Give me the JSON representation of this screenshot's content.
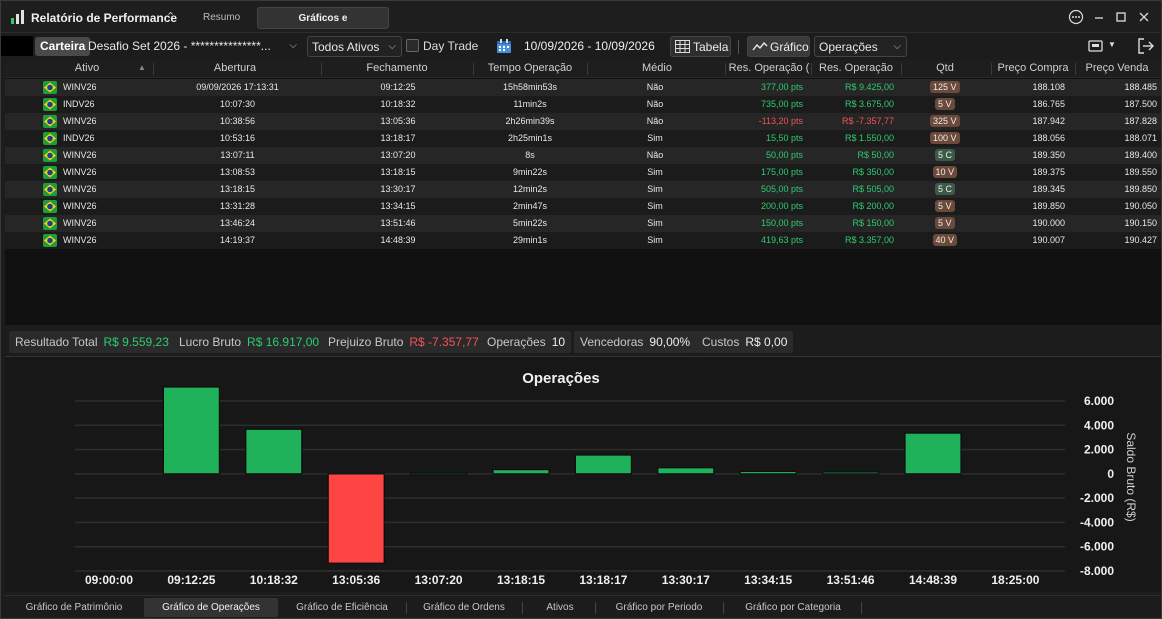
{
  "app": {
    "title": "Relatório de Performance",
    "tabs": [
      "Resumo",
      "Gráficos e Operações"
    ],
    "active_tab": "Gráficos e Operações"
  },
  "toolbar": {
    "carteira_label": "Carteira",
    "account_value": "Desafio Set 2026 - ***************...",
    "assets_value": "Todos Ativos",
    "daytrade_label": "Day Trade",
    "daytrade_checked": false,
    "date_range": "10/09/2026 - 10/09/2026",
    "tabela_label": "Tabela",
    "grafico_label": "Gráfico",
    "view_value": "Operações"
  },
  "table": {
    "columns": [
      "Ativo",
      "Abertura",
      "Fechamento",
      "Tempo Operação",
      "Médio",
      "Res. Operação (",
      "Res. Operação",
      "Qtd",
      "Preço Compra",
      "Preço Venda"
    ],
    "rows": [
      {
        "ativo": "WINV26",
        "abertura": "09/09/2026 17:13:31",
        "fechamento": "09:12:25",
        "tempo": "15h58min53s",
        "medio": "Não",
        "res_pts": "377,00 pts",
        "res_rs": "R$ 9.425,00",
        "qtd": "125 V",
        "compra": "188.108",
        "venda": "188.485",
        "sign": "pos"
      },
      {
        "ativo": "INDV26",
        "abertura": "10:07:30",
        "fechamento": "10:18:32",
        "tempo": "11min2s",
        "medio": "Não",
        "res_pts": "735,00 pts",
        "res_rs": "R$ 3.675,00",
        "qtd": "5 V",
        "compra": "186.765",
        "venda": "187.500",
        "sign": "pos"
      },
      {
        "ativo": "WINV26",
        "abertura": "10:38:56",
        "fechamento": "13:05:36",
        "tempo": "2h26min39s",
        "medio": "Não",
        "res_pts": "-113,20 pts",
        "res_rs": "R$ -7.357,77",
        "qtd": "325 V",
        "compra": "187.942",
        "venda": "187.828",
        "sign": "neg"
      },
      {
        "ativo": "INDV26",
        "abertura": "10:53:16",
        "fechamento": "13:18:17",
        "tempo": "2h25min1s",
        "medio": "Sim",
        "res_pts": "15,50 pts",
        "res_rs": "R$ 1.550,00",
        "qtd": "100 V",
        "compra": "188.056",
        "venda": "188.071",
        "sign": "pos"
      },
      {
        "ativo": "WINV26",
        "abertura": "13:07:11",
        "fechamento": "13:07:20",
        "tempo": "8s",
        "medio": "Não",
        "res_pts": "50,00 pts",
        "res_rs": "R$ 50,00",
        "qtd": "5 C",
        "compra": "189.350",
        "venda": "189.400",
        "sign": "pos"
      },
      {
        "ativo": "WINV26",
        "abertura": "13:08:53",
        "fechamento": "13:18:15",
        "tempo": "9min22s",
        "medio": "Sim",
        "res_pts": "175,00 pts",
        "res_rs": "R$ 350,00",
        "qtd": "10 V",
        "compra": "189.375",
        "venda": "189.550",
        "sign": "pos"
      },
      {
        "ativo": "WINV26",
        "abertura": "13:18:15",
        "fechamento": "13:30:17",
        "tempo": "12min2s",
        "medio": "Sim",
        "res_pts": "505,00 pts",
        "res_rs": "R$ 505,00",
        "qtd": "5 C",
        "compra": "189.345",
        "venda": "189.850",
        "sign": "pos"
      },
      {
        "ativo": "WINV26",
        "abertura": "13:31:28",
        "fechamento": "13:34:15",
        "tempo": "2min47s",
        "medio": "Sim",
        "res_pts": "200,00 pts",
        "res_rs": "R$ 200,00",
        "qtd": "5 V",
        "compra": "189.850",
        "venda": "190.050",
        "sign": "pos"
      },
      {
        "ativo": "WINV26",
        "abertura": "13:46:24",
        "fechamento": "13:51:46",
        "tempo": "5min22s",
        "medio": "Sim",
        "res_pts": "150,00 pts",
        "res_rs": "R$ 150,00",
        "qtd": "5 V",
        "compra": "190.000",
        "venda": "190.150",
        "sign": "pos"
      },
      {
        "ativo": "WINV26",
        "abertura": "14:19:37",
        "fechamento": "14:48:39",
        "tempo": "29min1s",
        "medio": "Sim",
        "res_pts": "419,63 pts",
        "res_rs": "R$ 3.357,00",
        "qtd": "40 V",
        "compra": "190.007",
        "venda": "190.427",
        "sign": "pos"
      }
    ]
  },
  "summary": [
    {
      "label": "Resultado Total",
      "value": "R$ 9.559,23",
      "sign": "pos"
    },
    {
      "label": "Lucro Bruto",
      "value": "R$ 16.917,00",
      "sign": "pos"
    },
    {
      "label": "Prejuizo Bruto",
      "value": "R$ -7.357,77",
      "sign": "neg"
    },
    {
      "label": "Operações",
      "value": "10",
      "sign": "neutral"
    },
    {
      "label": "Vencedoras",
      "value": "90,00%",
      "sign": "neutral"
    },
    {
      "label": "Custos",
      "value": "R$ 0,00",
      "sign": "neutral"
    }
  ],
  "colors": {
    "positive": "#1fb25a",
    "negative": "#ff4444",
    "pos_text": "#2ecc71",
    "neg_text": "#f05454"
  },
  "chart_data": {
    "type": "bar",
    "title": "Operações",
    "ylabel": "Saldo Bruto (R$)",
    "x_ticks": [
      "09:00:00",
      "09:12:25",
      "10:18:32",
      "13:05:36",
      "13:07:20",
      "13:18:15",
      "13:18:17",
      "13:30:17",
      "13:34:15",
      "13:51:46",
      "14:48:39",
      "18:25:00"
    ],
    "categories": [
      "09:12:25",
      "10:18:32",
      "13:05:36",
      "13:07:20",
      "13:18:15",
      "13:18:17",
      "13:30:17",
      "13:34:15",
      "13:51:46",
      "14:48:39"
    ],
    "values": [
      9425,
      3675,
      -7357.77,
      50,
      350,
      1550,
      505,
      200,
      150,
      3357
    ],
    "ylim": [
      -8000,
      6500
    ],
    "y_ticks": [
      6000,
      4000,
      2000,
      0,
      -2000,
      -4000,
      -6000,
      -8000
    ],
    "y_tick_labels": [
      "6.000",
      "4.000",
      "2.000",
      "0",
      "-2.000",
      "-4.000",
      "-6.000",
      "-8.000"
    ],
    "grid": true,
    "clipped_top": true
  },
  "bottom_tabs": [
    "Gráfico de Patrimônio",
    "Gráfico de Operações",
    "Gráfico de Eficiência",
    "Gráfico de Ordens",
    "Ativos",
    "Gráfico por Periodo",
    "Gráfico por Categoria"
  ],
  "active_bottom_tab": "Gráfico de Operações"
}
